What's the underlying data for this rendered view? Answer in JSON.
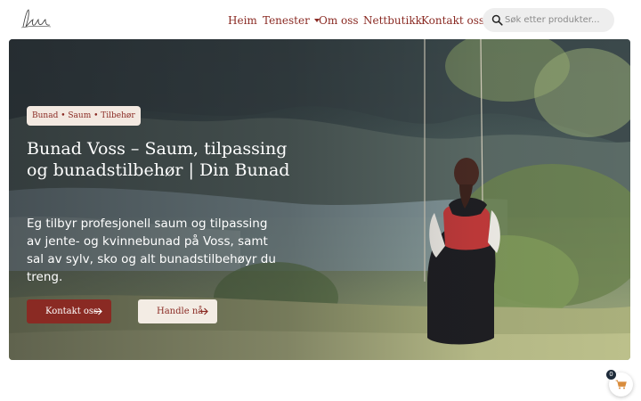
{
  "header": {
    "logo_icon": "handwritten-signature-logo",
    "nav": [
      {
        "label": "Heim"
      },
      {
        "label": "Tenester",
        "has_dropdown": true
      },
      {
        "label": "Om oss"
      },
      {
        "label": "Nettbutikk"
      },
      {
        "label": "Kontakt oss"
      }
    ],
    "search": {
      "placeholder": "Søk etter produkter...",
      "icon": "search-icon"
    }
  },
  "hero": {
    "badge": "Bunad • Saum • Tilbehør",
    "title": "Bunad Voss – Saum, tilpassing og bunadstilbehør | Din Bunad",
    "text": "Eg tilbyr profesjonell saum og tilpassing av jente- og kvinnebunad på Voss, samt sal av sylv, sko og alt bunadstilbehøyr du treng.",
    "primary_button": "Kontakt oss",
    "secondary_button": "Handle nå",
    "button_icon": "arrow-right-icon"
  },
  "cart": {
    "count": "0",
    "icon": "cart-icon"
  },
  "colors": {
    "accent": "#8a2a23",
    "badge_bg": "#f3e9e1",
    "search_bg": "#eeeeee"
  }
}
